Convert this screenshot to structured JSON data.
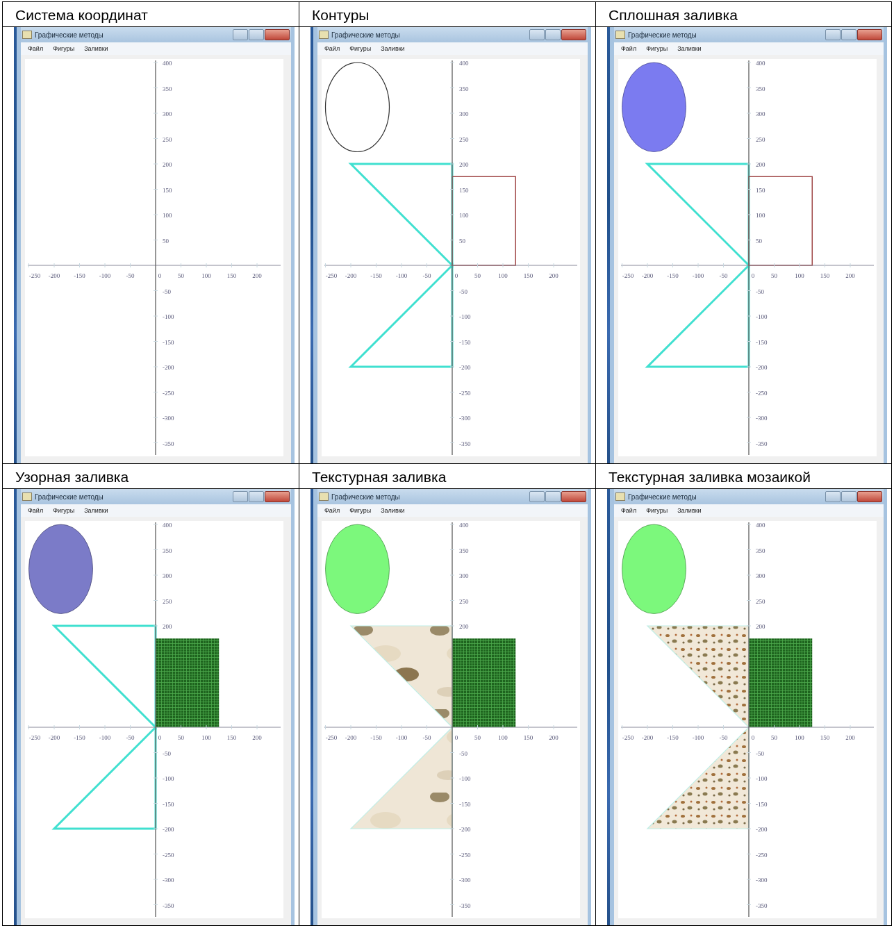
{
  "panels": [
    {
      "caption": "Система координат",
      "window": {
        "title": "Графические методы",
        "menu": [
          "Файл",
          "Фигуры",
          "Заливки"
        ]
      },
      "axes": {
        "x_ticks": [
          "-250",
          "-200",
          "-150",
          "-100",
          "-50",
          "0",
          "50",
          "100",
          "150",
          "200"
        ],
        "y_ticks_upper": [
          "400",
          "350",
          "300",
          "250",
          "200",
          "150",
          "100",
          "50"
        ],
        "y_ticks_lower": [
          "-50",
          "-100",
          "-150",
          "-200",
          "-250",
          "-300",
          "-350"
        ]
      }
    },
    {
      "caption": "Контуры",
      "window": {
        "title": "Графические методы",
        "menu": [
          "Файл",
          "Фигуры",
          "Заливки"
        ]
      },
      "axes": {
        "x_ticks": [
          "-250",
          "-200",
          "-150",
          "-100",
          "-50",
          "0",
          "50",
          "100",
          "150",
          "200"
        ],
        "y_ticks_upper": [
          "400",
          "350",
          "300",
          "250",
          "200",
          "150",
          "100",
          "50"
        ],
        "y_ticks_lower": [
          "-50",
          "-100",
          "-150",
          "-200",
          "-250",
          "-300",
          "-350"
        ]
      },
      "figures": [
        {
          "kind": "ellipse",
          "paint": {
            "kind": "outline",
            "color": "#303030"
          }
        },
        {
          "kind": "triangle",
          "paint": {
            "kind": "outline",
            "color": "#40e0d0"
          }
        },
        {
          "kind": "triangle",
          "paint": {
            "kind": "outline",
            "color": "#40e0d0"
          }
        },
        {
          "kind": "rectangle",
          "paint": {
            "kind": "outline",
            "color": "#a04848"
          }
        }
      ]
    },
    {
      "caption": "Сплошная заливка",
      "window": {
        "title": "Графические методы",
        "menu": [
          "Файл",
          "Фигуры",
          "Заливки"
        ]
      },
      "axes": {
        "x_ticks": [
          "-250",
          "-200",
          "-150",
          "-100",
          "-50",
          "0",
          "50",
          "100",
          "150",
          "200"
        ],
        "y_ticks_upper": [
          "400",
          "350",
          "300",
          "250",
          "200",
          "150",
          "100",
          "50"
        ],
        "y_ticks_lower": [
          "-50",
          "-100",
          "-150",
          "-200",
          "-250",
          "-300",
          "-350"
        ]
      },
      "figures": [
        {
          "kind": "ellipse",
          "paint": {
            "kind": "solid",
            "color": "#7b7bf0"
          }
        },
        {
          "kind": "triangle",
          "paint": {
            "kind": "outline",
            "color": "#40e0d0"
          }
        },
        {
          "kind": "triangle",
          "paint": {
            "kind": "outline",
            "color": "#40e0d0"
          }
        },
        {
          "kind": "rectangle",
          "paint": {
            "kind": "outline",
            "color": "#a04848"
          }
        }
      ]
    },
    {
      "caption": "Узорная заливка",
      "window": {
        "title": "Графические методы",
        "menu": [
          "Файл",
          "Фигуры",
          "Заливки"
        ]
      },
      "axes": {
        "x_ticks": [
          "-250",
          "-200",
          "-150",
          "-100",
          "-50",
          "0",
          "50",
          "100",
          "150",
          "200"
        ],
        "y_ticks_upper": [
          "400",
          "350",
          "300",
          "250",
          "200"
        ],
        "y_ticks_lower": [
          "-50",
          "-100",
          "-150",
          "-200",
          "-250",
          "-300",
          "-350"
        ]
      },
      "figures": [
        {
          "kind": "ellipse",
          "paint": {
            "kind": "solid",
            "color": "#7b7bc8"
          }
        },
        {
          "kind": "triangle",
          "paint": {
            "kind": "outline",
            "color": "#40e0d0"
          }
        },
        {
          "kind": "triangle",
          "paint": {
            "kind": "outline",
            "color": "#40e0d0"
          }
        },
        {
          "kind": "rectangle",
          "paint": {
            "kind": "pattern",
            "color": "#1e641e"
          }
        }
      ]
    },
    {
      "caption": "Текстурная заливка",
      "window": {
        "title": "Графические методы",
        "menu": [
          "Файл",
          "Фигуры",
          "Заливки"
        ]
      },
      "axes": {
        "x_ticks": [
          "-250",
          "-200",
          "-150",
          "-100",
          "-50",
          "0",
          "50",
          "100",
          "150",
          "200"
        ],
        "y_ticks_upper": [
          "400",
          "350",
          "300",
          "250",
          "200"
        ],
        "y_ticks_lower": [
          "-50",
          "-100",
          "-150",
          "-200",
          "-250",
          "-300",
          "-350"
        ]
      },
      "figures": [
        {
          "kind": "ellipse",
          "paint": {
            "kind": "solid",
            "color": "#7cf87c"
          }
        },
        {
          "kind": "triangle",
          "paint": {
            "kind": "texture",
            "color": "#efe6d6"
          }
        },
        {
          "kind": "triangle",
          "paint": {
            "kind": "texture",
            "color": "#efe6d6"
          }
        },
        {
          "kind": "rectangle",
          "paint": {
            "kind": "pattern",
            "color": "#1e641e"
          }
        }
      ]
    },
    {
      "caption": "Текстурная заливка мозаикой",
      "window": {
        "title": "Графические методы",
        "menu": [
          "Файл",
          "Фигуры",
          "Заливки"
        ]
      },
      "axes": {
        "x_ticks": [
          "-250",
          "-200",
          "-150",
          "-100",
          "-50",
          "0",
          "50",
          "100",
          "150",
          "200"
        ],
        "y_ticks_upper": [
          "400",
          "350",
          "300",
          "250",
          "200"
        ],
        "y_ticks_lower": [
          "-50",
          "-100",
          "-150",
          "-200",
          "-250",
          "-300",
          "-350"
        ]
      },
      "figures": [
        {
          "kind": "ellipse",
          "paint": {
            "kind": "solid",
            "color": "#7cf87c"
          }
        },
        {
          "kind": "triangle",
          "paint": {
            "kind": "mosaic",
            "color": "#f1e8d8"
          }
        },
        {
          "kind": "triangle",
          "paint": {
            "kind": "mosaic",
            "color": "#f1e8d8"
          }
        },
        {
          "kind": "rectangle",
          "paint": {
            "kind": "pattern",
            "color": "#1e641e"
          }
        }
      ]
    }
  ]
}
